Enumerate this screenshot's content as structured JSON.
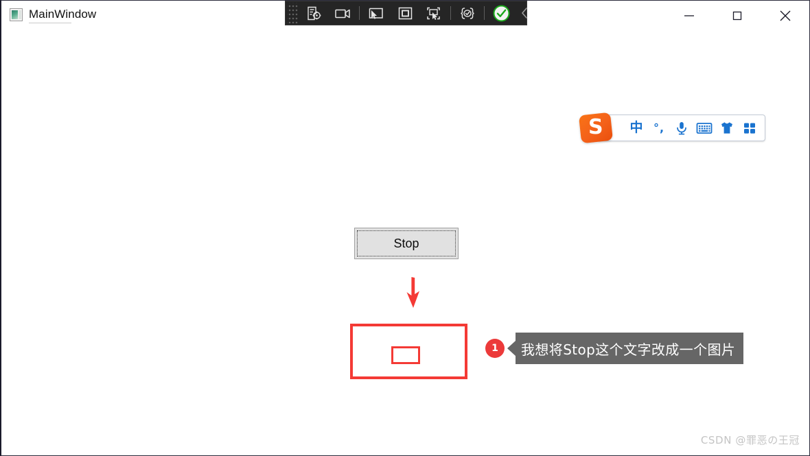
{
  "window": {
    "title": "MainWindow",
    "icon": "app-window-icon",
    "controls": [
      {
        "name": "minimize-button",
        "glyph": "minimize-icon",
        "label": "Minimize"
      },
      {
        "name": "maximize-button",
        "glyph": "maximize-icon",
        "label": "Maximize"
      },
      {
        "name": "close-button",
        "glyph": "close-icon",
        "label": "Close"
      }
    ]
  },
  "automation_toolbar": {
    "background_color": "#252525",
    "grip": "drag-grip",
    "buttons": [
      {
        "name": "inspect-element-button",
        "icon": "document-target-icon"
      },
      {
        "name": "record-video-button",
        "icon": "video-camera-icon"
      },
      {
        "name": "select-control-button",
        "icon": "cursor-window-icon"
      },
      {
        "name": "highlight-frame-button",
        "icon": "square-frame-icon"
      },
      {
        "name": "pick-element-button",
        "icon": "window-cursor-brackets-icon"
      },
      {
        "name": "validate-expression-button",
        "icon": "braces-check-icon"
      },
      {
        "name": "confirm-button",
        "icon": "green-check-circle-icon"
      },
      {
        "name": "collapse-toolbar-button",
        "icon": "chevron-left-icon"
      }
    ]
  },
  "ime_bar": {
    "logo": "sogou-logo",
    "logo_letter": "S",
    "logo_color": "#f4611a",
    "accent_color": "#1a73cf",
    "buttons": [
      {
        "name": "ime-language-mode-button",
        "icon": "chinese-character-icon",
        "label": "中"
      },
      {
        "name": "ime-punctuation-button",
        "icon": "punctuation-icon",
        "label": "°,"
      },
      {
        "name": "ime-voice-input-button",
        "icon": "microphone-icon"
      },
      {
        "name": "ime-soft-keyboard-button",
        "icon": "keyboard-icon"
      },
      {
        "name": "ime-skin-button",
        "icon": "tshirt-icon"
      },
      {
        "name": "ime-toolbox-button",
        "icon": "grid-squares-icon"
      }
    ]
  },
  "canvas": {
    "stop_button": {
      "label": "Stop",
      "background_color": "#e1e1e1",
      "border_color": "#a0a0a0",
      "focus_style": "dotted"
    },
    "arrow": {
      "name": "red-down-arrow",
      "color": "#f43a35",
      "direction": "down"
    },
    "target_box": {
      "name": "red-highlight-box",
      "color": "#f43a35",
      "inner_box": "red-inner-placeholder-box"
    }
  },
  "annotation": {
    "badge_number": "1",
    "badge_color": "#ec3a3a",
    "bubble_color": "#666666",
    "text": "我想将Stop这个文字改成一个图片"
  },
  "watermark": {
    "text": "CSDN @罪恶の王冠"
  }
}
